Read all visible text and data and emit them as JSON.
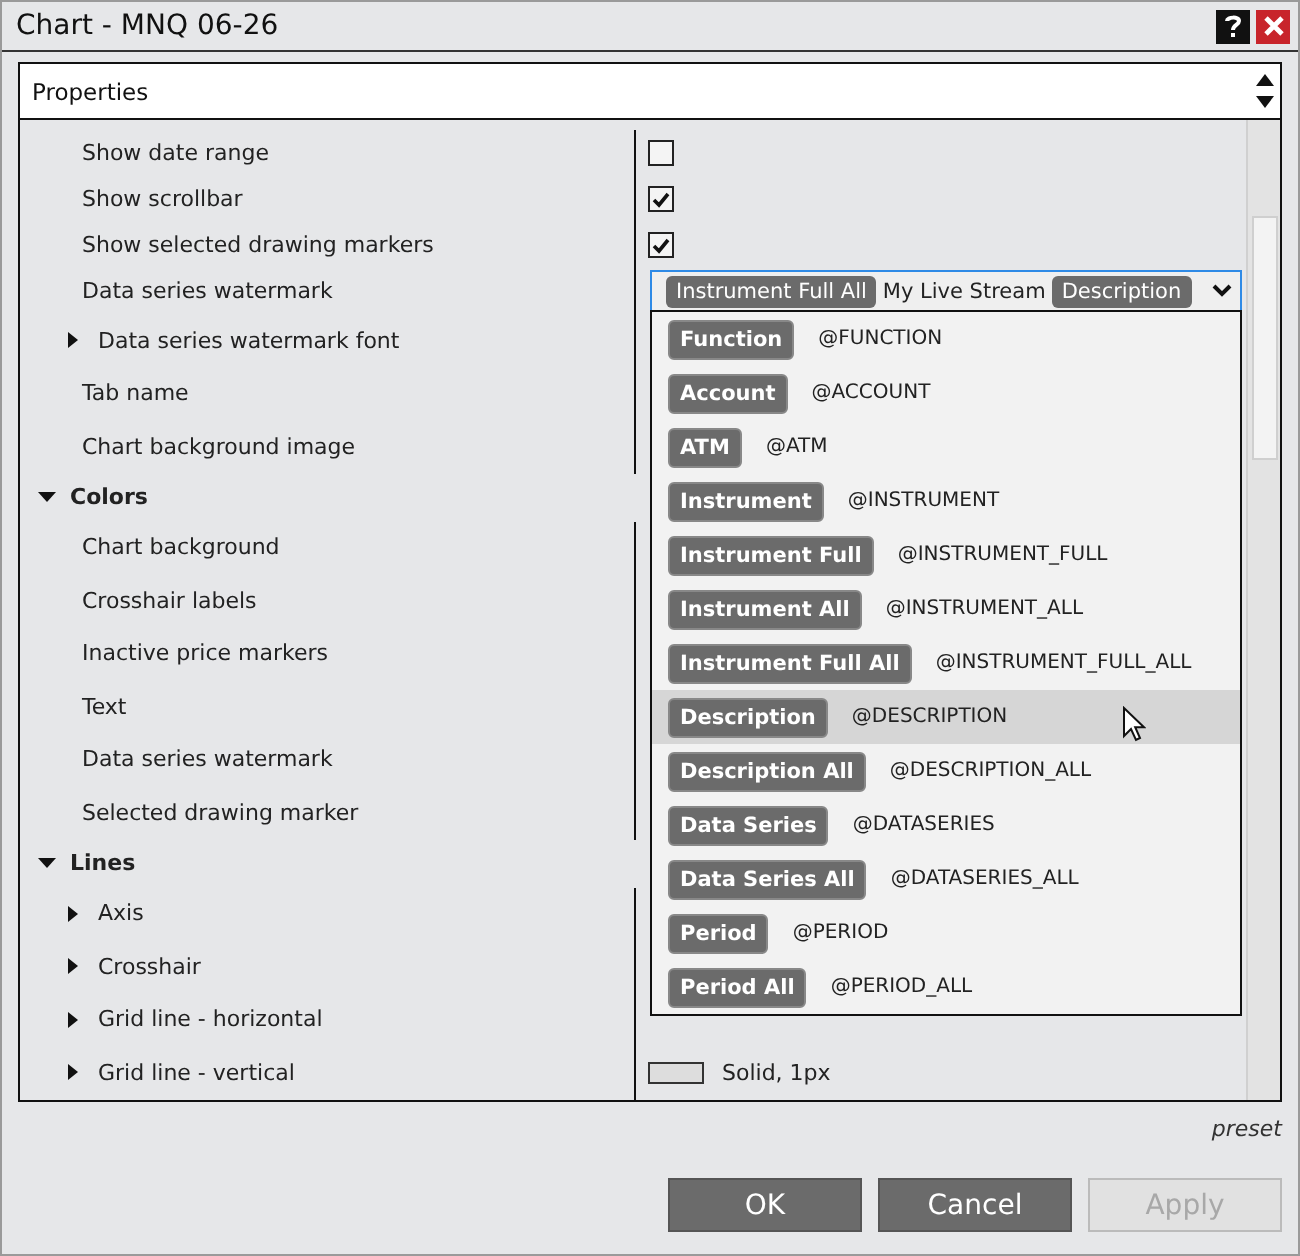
{
  "window": {
    "title": "Chart - MNQ 06-26"
  },
  "header": {
    "label": "Properties"
  },
  "rows": [
    {
      "kind": "row",
      "label": "Show date range",
      "value": {
        "kind": "checkbox",
        "checked": false
      }
    },
    {
      "kind": "row",
      "label": "Show scrollbar",
      "value": {
        "kind": "checkbox",
        "checked": true
      }
    },
    {
      "kind": "row",
      "label": "Show selected drawing markers",
      "value": {
        "kind": "checkbox",
        "checked": true
      }
    },
    {
      "kind": "row",
      "label": "Data series watermark",
      "value": {
        "kind": "dropdown"
      }
    },
    {
      "kind": "group",
      "label": "Data series watermark font",
      "expanded": false
    },
    {
      "kind": "row",
      "label": "Tab name"
    },
    {
      "kind": "row",
      "label": "Chart background image"
    },
    {
      "kind": "category",
      "label": "Colors",
      "expanded": true,
      "children": [
        {
          "kind": "row",
          "label": "Chart background"
        },
        {
          "kind": "row",
          "label": "Crosshair labels"
        },
        {
          "kind": "row",
          "label": "Inactive price markers"
        },
        {
          "kind": "row",
          "label": "Text"
        },
        {
          "kind": "row",
          "label": "Data series watermark"
        },
        {
          "kind": "row",
          "label": "Selected drawing marker"
        }
      ]
    },
    {
      "kind": "category",
      "label": "Lines",
      "expanded": true,
      "children": [
        {
          "kind": "group",
          "label": "Axis",
          "expanded": false
        },
        {
          "kind": "group",
          "label": "Crosshair",
          "expanded": false
        },
        {
          "kind": "group",
          "label": "Grid line - horizontal",
          "expanded": false
        },
        {
          "kind": "group",
          "label": "Grid line - vertical",
          "expanded": false,
          "value": {
            "kind": "line",
            "text": "Solid, 1px"
          }
        }
      ]
    }
  ],
  "watermark_dropdown": {
    "field": [
      {
        "kind": "token",
        "text": "Instrument Full All"
      },
      {
        "kind": "text",
        "text": "My Live Stream"
      },
      {
        "kind": "token",
        "text": "Description"
      }
    ],
    "options": [
      {
        "tag": "Function",
        "code": "@FUNCTION",
        "highlighted": false
      },
      {
        "tag": "Account",
        "code": "@ACCOUNT",
        "highlighted": false
      },
      {
        "tag": "ATM",
        "code": "@ATM",
        "highlighted": false
      },
      {
        "tag": "Instrument",
        "code": "@INSTRUMENT",
        "highlighted": false
      },
      {
        "tag": "Instrument Full",
        "code": "@INSTRUMENT_FULL",
        "highlighted": false
      },
      {
        "tag": "Instrument All",
        "code": "@INSTRUMENT_ALL",
        "highlighted": false
      },
      {
        "tag": "Instrument Full All",
        "code": "@INSTRUMENT_FULL_ALL",
        "highlighted": false
      },
      {
        "tag": "Description",
        "code": "@DESCRIPTION",
        "highlighted": true
      },
      {
        "tag": "Description All",
        "code": "@DESCRIPTION_ALL",
        "highlighted": false
      },
      {
        "tag": "Data Series",
        "code": "@DATASERIES",
        "highlighted": false
      },
      {
        "tag": "Data Series All",
        "code": "@DATASERIES_ALL",
        "highlighted": false
      },
      {
        "tag": "Period",
        "code": "@PERIOD",
        "highlighted": false
      },
      {
        "tag": "Period All",
        "code": "@PERIOD_ALL",
        "highlighted": false
      }
    ]
  },
  "preset": "preset",
  "buttons": [
    {
      "label": "OK",
      "disabled": false
    },
    {
      "label": "Cancel",
      "disabled": false
    },
    {
      "label": "Apply",
      "disabled": true
    }
  ]
}
